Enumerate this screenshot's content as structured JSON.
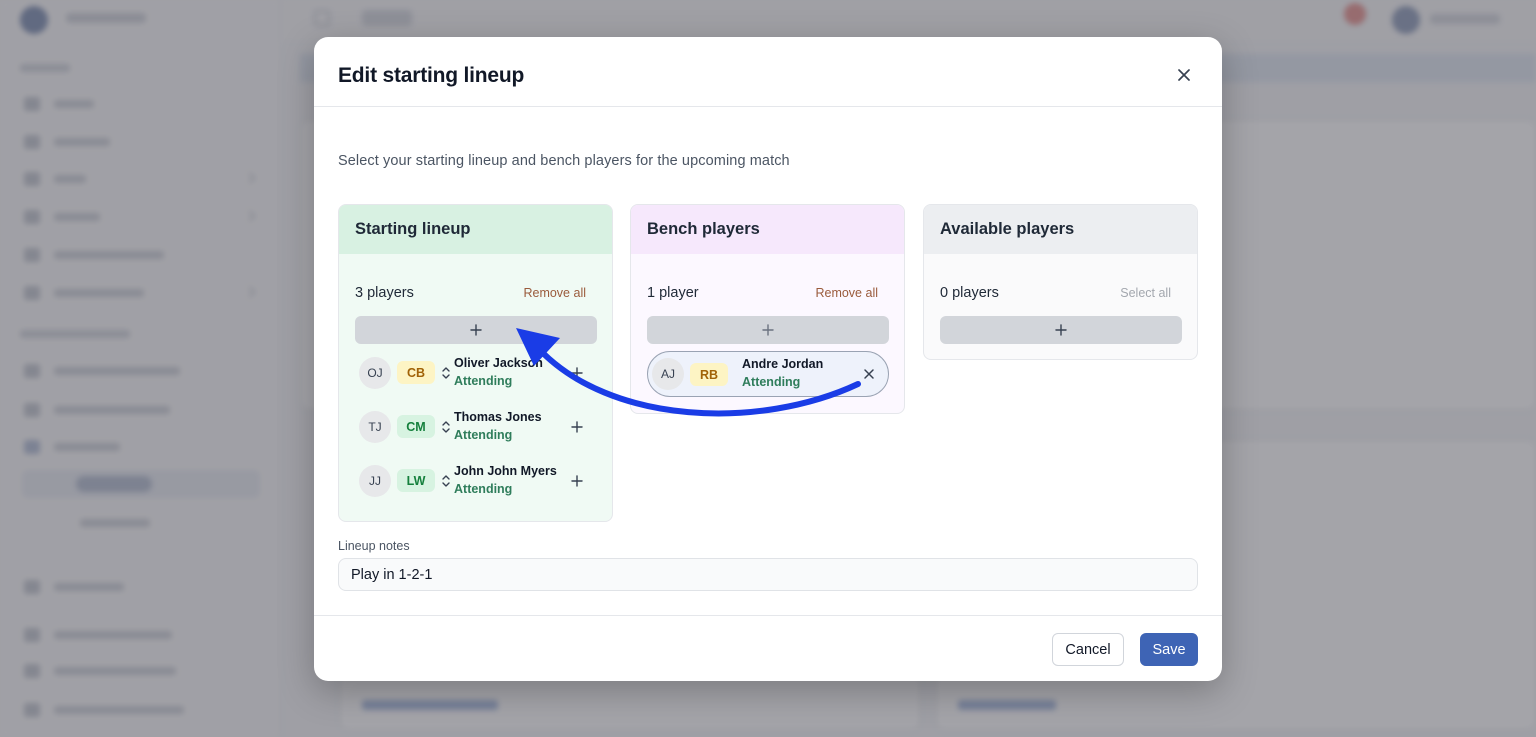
{
  "modal": {
    "title": "Edit starting lineup",
    "description": "Select your starting lineup and bench players for the upcoming match"
  },
  "starting": {
    "title": "Starting lineup",
    "count": "3 players",
    "action": "Remove all",
    "players": [
      {
        "initials": "OJ",
        "position": "CB",
        "name": "Oliver Jackson",
        "status": "Attending"
      },
      {
        "initials": "TJ",
        "position": "CM",
        "name": "Thomas Jones",
        "status": "Attending"
      },
      {
        "initials": "JJ",
        "position": "LW",
        "name": "John John Myers",
        "status": "Attending"
      }
    ]
  },
  "bench": {
    "title": "Bench players",
    "count": "1 player",
    "action": "Remove all",
    "players": [
      {
        "initials": "AJ",
        "position": "RB",
        "name": "Andre Jordan",
        "status": "Attending"
      }
    ]
  },
  "available": {
    "title": "Available players",
    "count": "0 players",
    "action": "Select all"
  },
  "notes": {
    "label": "Lineup notes",
    "value": "Play in 1-2-1"
  },
  "footer": {
    "cancel": "Cancel",
    "save": "Save"
  },
  "colors": {
    "accent": "#3e64b5",
    "arrow": "#1a3ce6",
    "attending": "#2f7d5b"
  }
}
